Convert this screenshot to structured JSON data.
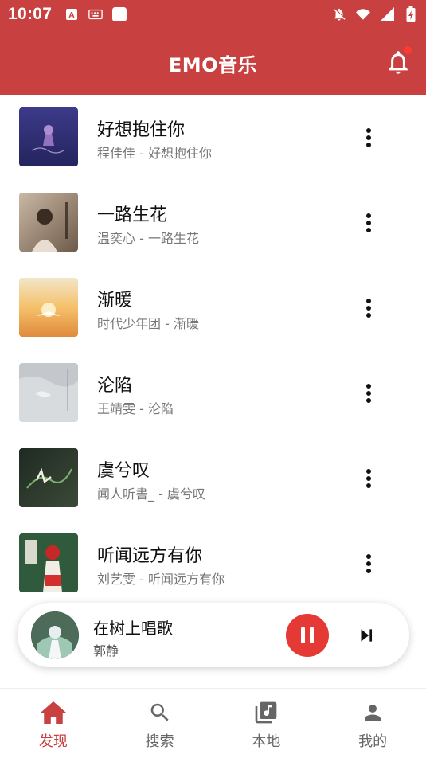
{
  "status_bar": {
    "time": "10:07"
  },
  "app_bar": {
    "title": "EMO音乐"
  },
  "songs": [
    {
      "title": "好想抱住你",
      "subtitle": "程佳佳 - 好想抱住你"
    },
    {
      "title": "一路生花",
      "subtitle": "温奕心 - 一路生花"
    },
    {
      "title": "渐暖",
      "subtitle": "时代少年团 - 渐暖"
    },
    {
      "title": "沦陷",
      "subtitle": "王靖雯 - 沦陷"
    },
    {
      "title": "虞兮叹",
      "subtitle": "闻人听書_ - 虞兮叹"
    },
    {
      "title": "听闻远方有你",
      "subtitle": "刘艺雯 - 听闻远方有你"
    }
  ],
  "mini_player": {
    "title": "在树上唱歌",
    "artist": "郭静"
  },
  "bottom_nav": [
    {
      "label": "发现",
      "icon": "home-icon",
      "active": true
    },
    {
      "label": "搜索",
      "icon": "search-icon",
      "active": false
    },
    {
      "label": "本地",
      "icon": "music-library-icon",
      "active": false
    },
    {
      "label": "我的",
      "icon": "person-icon",
      "active": false
    }
  ],
  "colors": {
    "primary": "#c8403f",
    "accent": "#e53935",
    "badge": "#ff3b30"
  }
}
